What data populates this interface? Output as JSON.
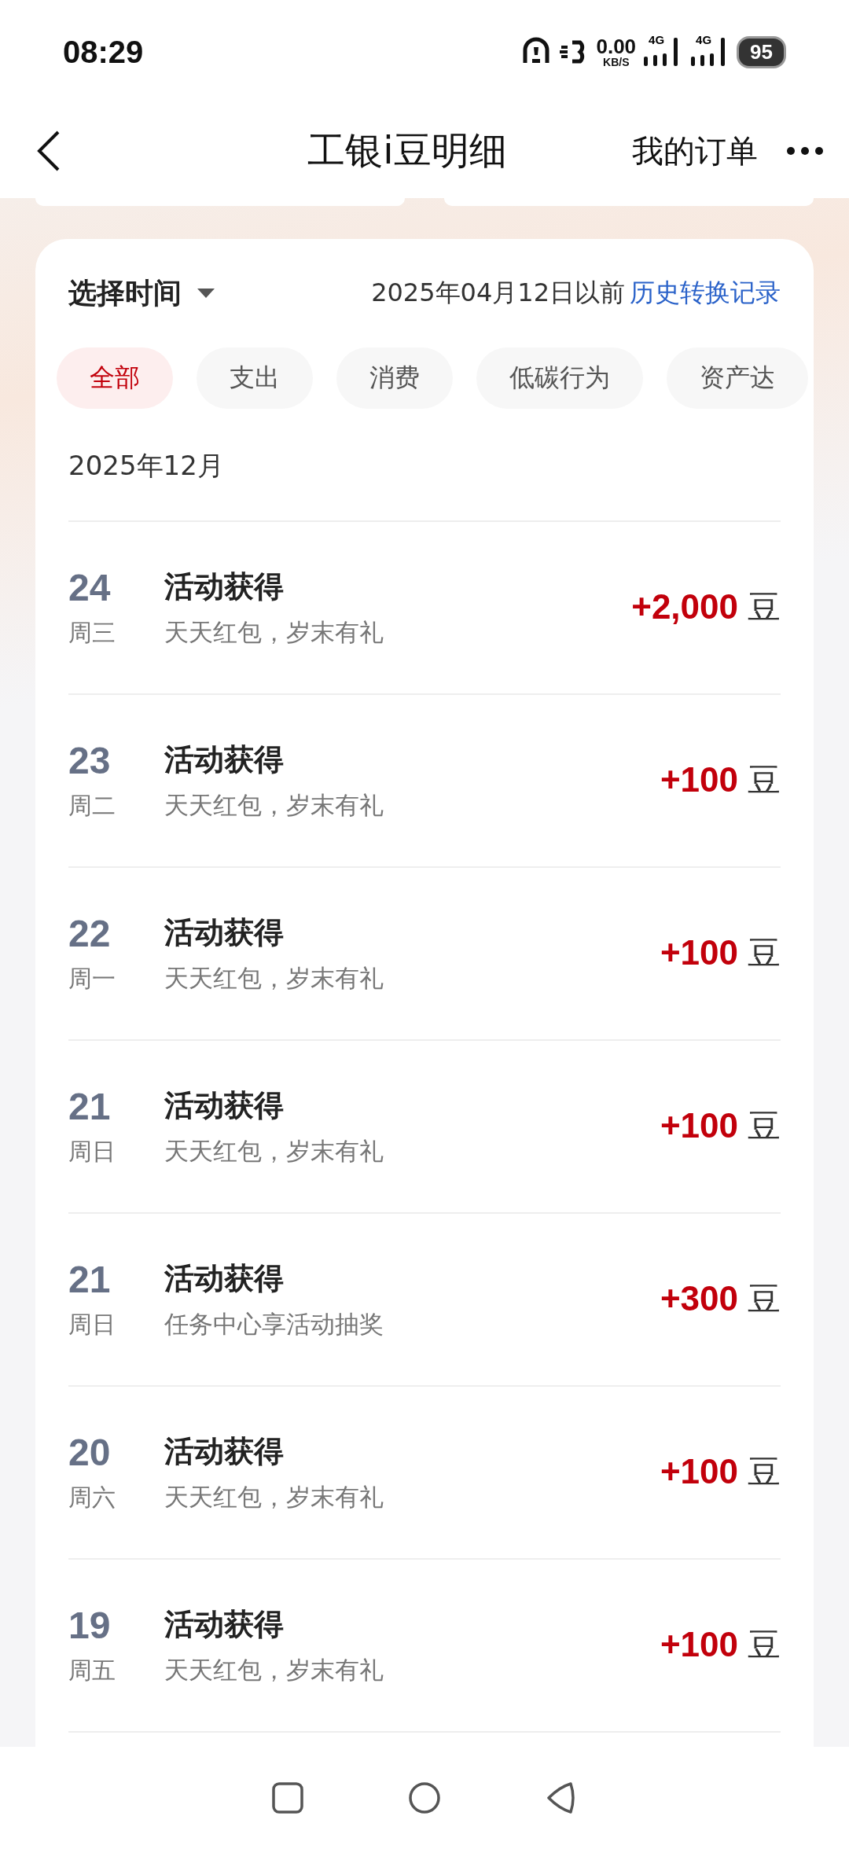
{
  "status_bar": {
    "time": "08:29",
    "net_speed": "0.00",
    "net_unit": "KB/S",
    "signals": [
      "4G",
      "4G"
    ],
    "battery": "95"
  },
  "header": {
    "title": "工银i豆明细",
    "action": "我的订单"
  },
  "filter": {
    "time_picker": "选择时间",
    "cutoff": "2025年04月12日以前",
    "history_link": "历史转换记录"
  },
  "chips": [
    {
      "label": "全部",
      "selected": true
    },
    {
      "label": "支出",
      "selected": false
    },
    {
      "label": "消费",
      "selected": false
    },
    {
      "label": "低碳行为",
      "selected": false
    },
    {
      "label": "资产达",
      "selected": false
    }
  ],
  "month": "2025年12月",
  "records": [
    {
      "day": "24",
      "weekday": "周三",
      "title": "活动获得",
      "desc": "天天红包，岁末有礼",
      "amount": "+2,000",
      "unit": "豆"
    },
    {
      "day": "23",
      "weekday": "周二",
      "title": "活动获得",
      "desc": "天天红包，岁末有礼",
      "amount": "+100",
      "unit": "豆"
    },
    {
      "day": "22",
      "weekday": "周一",
      "title": "活动获得",
      "desc": "天天红包，岁末有礼",
      "amount": "+100",
      "unit": "豆"
    },
    {
      "day": "21",
      "weekday": "周日",
      "title": "活动获得",
      "desc": "天天红包，岁末有礼",
      "amount": "+100",
      "unit": "豆"
    },
    {
      "day": "21",
      "weekday": "周日",
      "title": "活动获得",
      "desc": "任务中心享活动抽奖",
      "amount": "+300",
      "unit": "豆"
    },
    {
      "day": "20",
      "weekday": "周六",
      "title": "活动获得",
      "desc": "天天红包，岁末有礼",
      "amount": "+100",
      "unit": "豆"
    },
    {
      "day": "19",
      "weekday": "周五",
      "title": "活动获得",
      "desc": "天天红包，岁末有礼",
      "amount": "+100",
      "unit": "豆"
    }
  ]
}
